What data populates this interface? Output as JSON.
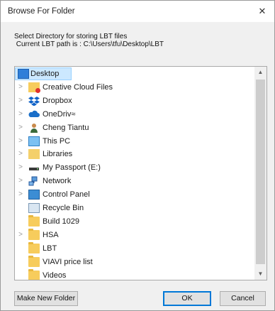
{
  "window": {
    "title": "Browse For Folder",
    "close_glyph": "✕"
  },
  "description": {
    "line1": "Select Directory for storing LBT files",
    "line2": " Current LBT path is : C:\\Users\\tfu\\Desktop\\LBT"
  },
  "tree": {
    "items": [
      {
        "label": "Desktop",
        "icon": "desktop-icon",
        "expander": "",
        "selected": true
      },
      {
        "label": "Creative Cloud Files",
        "icon": "creative-cloud-folder-icon",
        "expander": ">"
      },
      {
        "label": "Dropbox",
        "icon": "dropbox-icon",
        "expander": ">"
      },
      {
        "label": "OneDriv≈",
        "icon": "onedrive-icon",
        "expander": ">"
      },
      {
        "label": "Cheng Tiantu",
        "icon": "user-icon",
        "expander": ">"
      },
      {
        "label": "This PC",
        "icon": "this-pc-icon",
        "expander": ">"
      },
      {
        "label": "Libraries",
        "icon": "libraries-icon",
        "expander": ">"
      },
      {
        "label": "My Passport (E:)",
        "icon": "drive-icon",
        "expander": ">"
      },
      {
        "label": "Network",
        "icon": "network-icon",
        "expander": ">"
      },
      {
        "label": "Control Panel",
        "icon": "control-panel-icon",
        "expander": ">"
      },
      {
        "label": "Recycle Bin",
        "icon": "recycle-bin-icon",
        "expander": ""
      },
      {
        "label": "Build 1029",
        "icon": "folder-icon",
        "expander": ""
      },
      {
        "label": "HSA",
        "icon": "folder-icon",
        "expander": ">"
      },
      {
        "label": "LBT",
        "icon": "folder-icon",
        "expander": ""
      },
      {
        "label": "VIAVI price list",
        "icon": "folder-icon",
        "expander": ""
      },
      {
        "label": "Videos",
        "icon": "folder-icon",
        "expander": ""
      }
    ],
    "scroll_up_glyph": "▲",
    "scroll_down_glyph": "▼"
  },
  "buttons": {
    "new_folder": "Make New Folder",
    "ok": "OK",
    "cancel": "Cancel"
  },
  "colors": {
    "selection": "#cce8ff",
    "default_button_border": "#0078d7"
  }
}
